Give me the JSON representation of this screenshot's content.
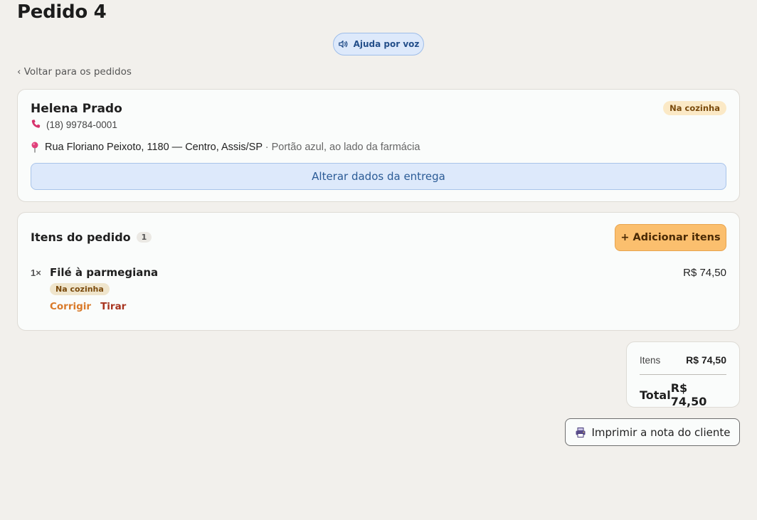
{
  "page": {
    "title": "Pedido 4"
  },
  "voice_help": {
    "label": "Ajuda por voz",
    "icon": "speaker-icon"
  },
  "nav": {
    "back_label": "‹ Voltar para os pedidos"
  },
  "customer": {
    "name": "Helena Prado",
    "status": "Na cozinha",
    "phone": "(18) 99784-0001",
    "phone_icon": "phone-icon",
    "address": "Rua Floriano Peixoto, 1180 — Centro, Assis/SP",
    "address_note": " · Portão azul, ao lado da farmácia",
    "address_icon": "pin-icon",
    "edit_delivery_label": "Alterar dados da entrega"
  },
  "items_section": {
    "title": "Itens do pedido",
    "count": "1",
    "add_label": "+ Adicionar itens",
    "items": [
      {
        "qty": "1×",
        "name": "Filé à parmegiana",
        "price": "R$ 74,50",
        "status": "Na cozinha",
        "fix_label": "Corrigir",
        "remove_label": "Tirar"
      }
    ]
  },
  "totals": {
    "items_label": "Itens",
    "items_value": "R$ 74,50",
    "total_label": "Total",
    "total_value": "R$ 74,50"
  },
  "print": {
    "label": "Imprimir a nota do cliente",
    "icon": "printer-icon"
  },
  "colors": {
    "background": "#f2f0ec",
    "accent_blue": "#dde9fb",
    "accent_orange": "#fbbf6e",
    "badge_kitchen": "#fbe9c6",
    "remove_red": "#a8341f",
    "fix_orange": "#d97a2a",
    "phone_pink": "#d6336c"
  }
}
